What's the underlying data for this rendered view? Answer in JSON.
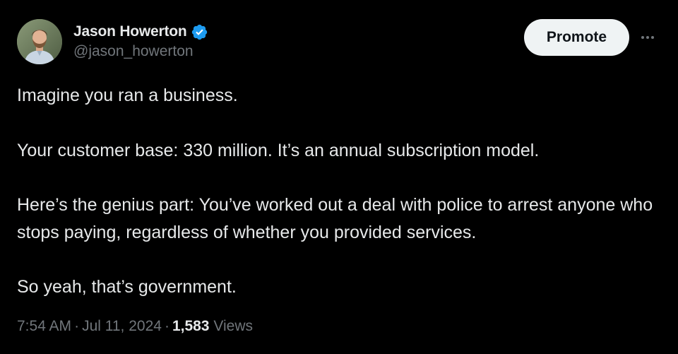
{
  "author": {
    "display_name": "Jason Howerton",
    "handle": "@jason_howerton",
    "verified_icon": "verified-badge-icon",
    "badge_color": "#1d9bf0"
  },
  "actions": {
    "promote_label": "Promote",
    "more_icon": "more-horizontal-icon"
  },
  "tweet": {
    "paragraphs": [
      "Imagine you ran a business.",
      "Your customer base: 330 million. It’s an annual subscription model.",
      "Here’s the genius part: You’ve worked out a deal with police to arrest anyone who stops paying, regardless of whether you provided services.",
      "So yeah, that’s government."
    ]
  },
  "meta": {
    "time": "7:54 AM",
    "separator": "·",
    "date": "Jul 11, 2024",
    "views_count": "1,583",
    "views_label": "Views"
  },
  "colors": {
    "background": "#000000",
    "text": "#e7e9ea",
    "secondary": "#71767b",
    "button_bg": "#eff3f4",
    "button_text": "#0f1419"
  }
}
